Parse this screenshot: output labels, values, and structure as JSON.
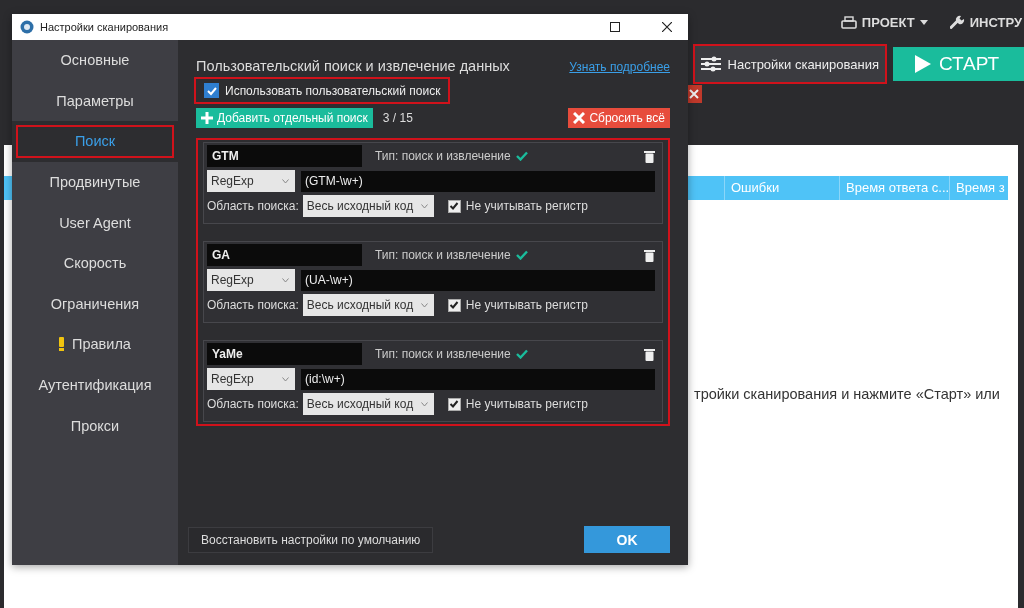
{
  "app": {
    "menus": [
      {
        "label": "ПРОЕКТ",
        "kind": "dropdown"
      },
      {
        "label": "ИНСТРУ",
        "kind": "tool"
      }
    ],
    "settings_button": {
      "label": "Настройки сканирования",
      "highlighted": true
    },
    "start_button": "СТАРТ",
    "table": {
      "columns": [
        "Ошибки",
        "Время ответа с...",
        "Время з"
      ]
    },
    "hint": "тройки сканирования и нажмите «Старт» или"
  },
  "dialog": {
    "title": "Настройки сканирования",
    "sidebar": {
      "items": [
        {
          "label": "Основные",
          "selected": false,
          "warning": false
        },
        {
          "label": "Параметры",
          "selected": false,
          "warning": false
        },
        {
          "label": "Поиск",
          "selected": true,
          "warning": false
        },
        {
          "label": "Продвинутые",
          "selected": false,
          "warning": false
        },
        {
          "label": "User Agent",
          "selected": false,
          "warning": false
        },
        {
          "label": "Скорость",
          "selected": false,
          "warning": false
        },
        {
          "label": "Ограничения",
          "selected": false,
          "warning": false
        },
        {
          "label": "Правила",
          "selected": false,
          "warning": true
        },
        {
          "label": "Аутентификация",
          "selected": false,
          "warning": false
        },
        {
          "label": "Прокси",
          "selected": false,
          "warning": false
        }
      ]
    },
    "heading": "Пользовательский поиск и извлечение данных",
    "learn_more_link": "Узнать подробнее",
    "use_custom_search": {
      "label": "Использовать пользовательский поиск",
      "checked": true
    },
    "add_button": "Добавить отдельный поиск",
    "counter": "3 / 15",
    "reset_button": "Сбросить всё",
    "searches": [
      {
        "name": "GTM",
        "type_label": "Тип: поиск и извлечение",
        "valid": true,
        "mode": "RegExp",
        "pattern": "(GTM-\\w+)",
        "scope_label": "Область поиска:",
        "scope": "Весь исходный код",
        "ignore_case": {
          "label": "Не учитывать регистр",
          "checked": true
        }
      },
      {
        "name": "GA",
        "type_label": "Тип: поиск и извлечение",
        "valid": true,
        "mode": "RegExp",
        "pattern": "(UA-\\w+)",
        "scope_label": "Область поиска:",
        "scope": "Весь исходный код",
        "ignore_case": {
          "label": "Не учитывать регистр",
          "checked": true
        }
      },
      {
        "name": "YaMe",
        "type_label": "Тип: поиск и извлечение",
        "valid": true,
        "mode": "RegExp",
        "pattern": "(id:\\w+)",
        "scope_label": "Область поиска:",
        "scope": "Весь исходный код",
        "ignore_case": {
          "label": "Не учитывать регистр",
          "checked": true
        }
      }
    ],
    "restore_button": "Восстановить настройки по умолчанию",
    "ok_button": "OK"
  }
}
